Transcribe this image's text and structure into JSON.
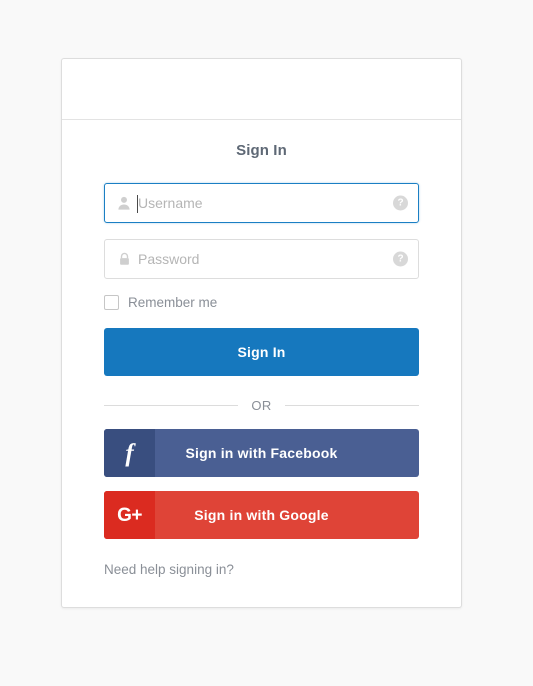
{
  "page": {
    "background_color": "#f9f9f9"
  },
  "card": {
    "header_empty": true,
    "title": "Sign In",
    "border_color": "#dddddd",
    "background_color": "#ffffff"
  },
  "form": {
    "username": {
      "placeholder": "Username",
      "value": "",
      "icon": "person-icon",
      "help_icon": "question-mark-icon",
      "focused": true,
      "focus_border_color": "#1b7fc4"
    },
    "password": {
      "placeholder": "Password",
      "value": "",
      "icon": "lock-icon",
      "help_icon": "question-mark-icon",
      "focused": false
    },
    "remember_me": {
      "label": "Remember me",
      "checked": false
    },
    "submit": {
      "label": "Sign In",
      "color": "#1678be"
    }
  },
  "divider": {
    "text": "OR"
  },
  "social": {
    "facebook": {
      "label": "Sign in with Facebook",
      "icon": "facebook-icon",
      "icon_glyph": "f",
      "color": "#4a5f93",
      "icon_box_color": "#394e7f"
    },
    "google": {
      "label": "Sign in with Google",
      "icon": "google-plus-icon",
      "icon_glyph": "G+",
      "color": "#df4437",
      "icon_box_color": "#db2b20"
    }
  },
  "footer": {
    "help_link": "Need help signing in?"
  }
}
